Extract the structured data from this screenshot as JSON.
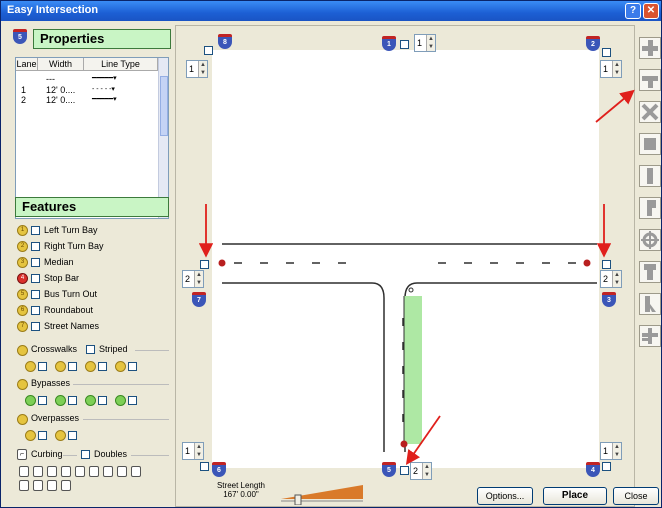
{
  "window": {
    "title": "Easy Intersection"
  },
  "titlebar": {
    "help_label": "?",
    "close_label": "✕"
  },
  "properties": {
    "heading": "Properties",
    "shield_number": "5",
    "columns": [
      "Lane",
      "Width",
      "Line Type"
    ],
    "rows": [
      {
        "lane": "",
        "width": "---",
        "line_type": "━━━━━▾"
      },
      {
        "lane": "1",
        "width": "12' 0....",
        "line_type": "- - - - -▾"
      },
      {
        "lane": "2",
        "width": "12' 0....",
        "line_type": "━━━━━▾"
      }
    ]
  },
  "features": {
    "heading": "Features",
    "items": [
      {
        "num": "1",
        "label": "Left Turn Bay"
      },
      {
        "num": "2",
        "label": "Right Turn Bay"
      },
      {
        "num": "3",
        "label": "Median"
      },
      {
        "num": "4",
        "label": "Stop Bar"
      },
      {
        "num": "5",
        "label": "Bus Turn Out"
      },
      {
        "num": "6",
        "label": "Roundabout"
      },
      {
        "num": "7",
        "label": "Street Names"
      }
    ],
    "crosswalks_label": "Crosswalks",
    "striped_label": "Striped",
    "bypasses_label": "Bypasses",
    "overpasses_label": "Overpasses",
    "curbing_label": "Curbing",
    "doubles_label": "Doubles"
  },
  "canvas": {
    "spinners": {
      "top_left": "1",
      "top_mid": "1",
      "top_right": "1",
      "mid_left": "2",
      "mid_right": "2",
      "bottom_left": "1",
      "bottom_mid": "2",
      "bottom_right": "1"
    },
    "shields": {
      "top_left": "8",
      "top_mid": "1",
      "top_right": "2",
      "mid_left": "7",
      "mid_right": "3",
      "bottom_left": "6",
      "bottom_mid": "5",
      "bottom_right": "4"
    },
    "road_color": "#2f2f2f",
    "median_color": "#aee8a4",
    "stopbar_color": "#b81f1f",
    "arrow_color": "#e0201c"
  },
  "bottom": {
    "street_length_label": "Street Length",
    "street_length_value": "167' 0.00\"",
    "options_label": "Options...",
    "place_label": "Place",
    "close_label": "Close"
  },
  "toolbar": {
    "tools": [
      "four-way-icon",
      "t-intersection-icon",
      "x-intersection-icon",
      "block-icon",
      "straight-road-icon",
      "curve-road-icon",
      "roundabout-icon",
      "merge-icon",
      "ramp-icon",
      "offset-icon"
    ]
  }
}
